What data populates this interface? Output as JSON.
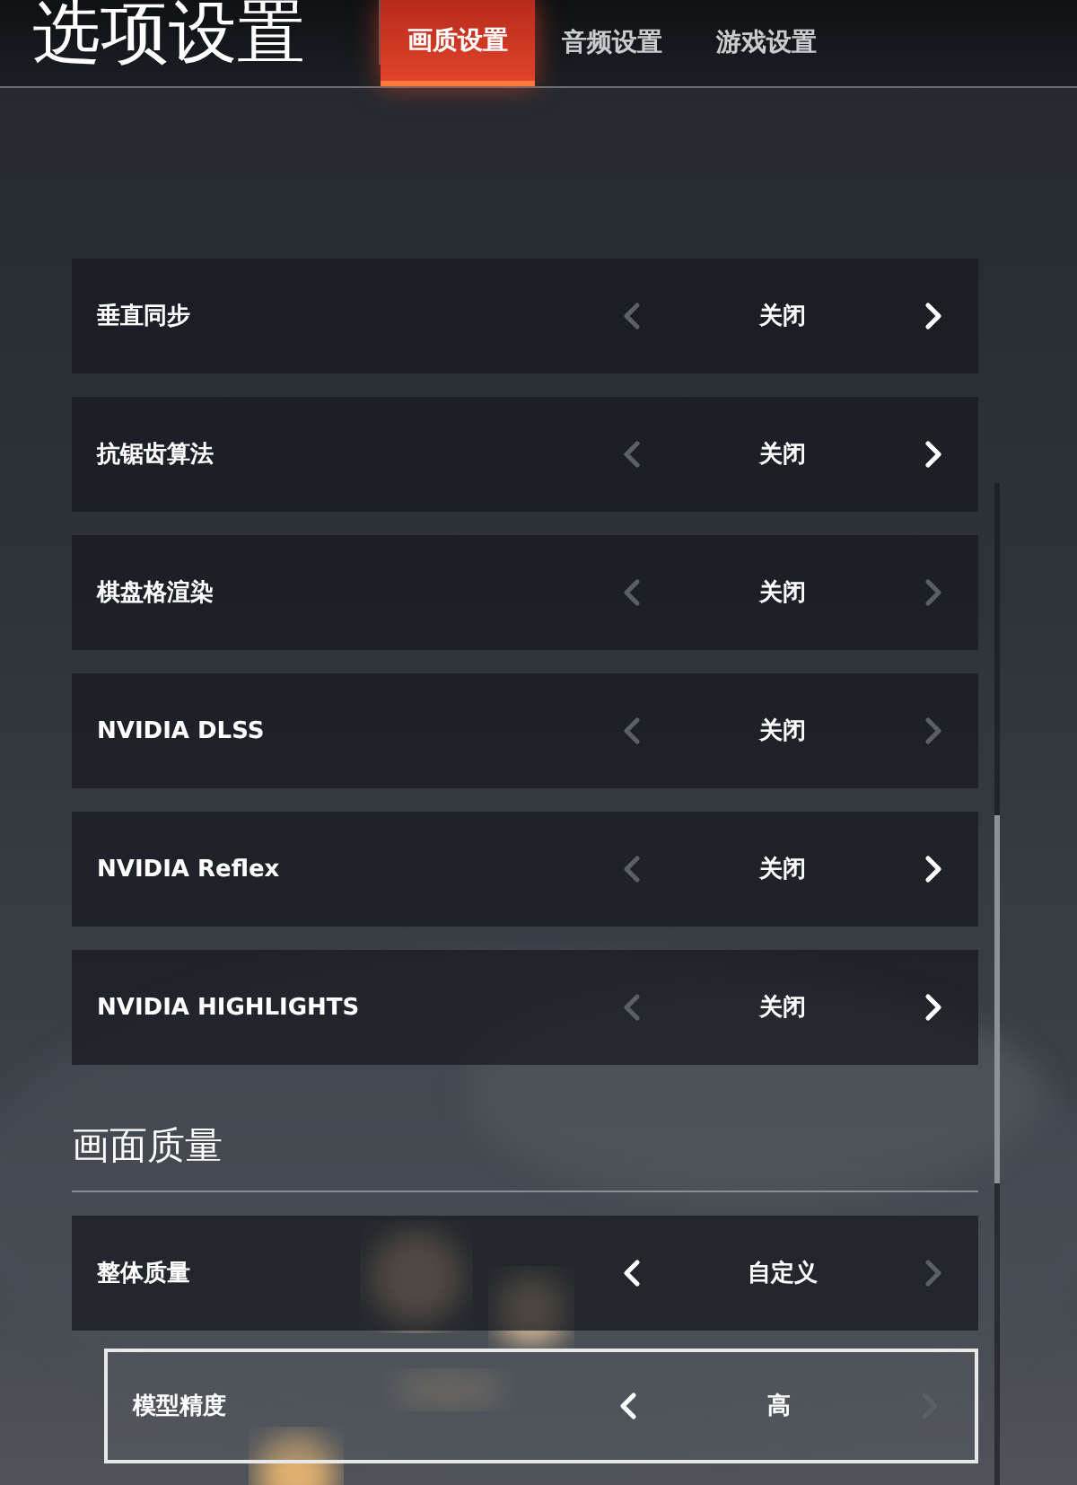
{
  "window": {
    "title": "选项设置"
  },
  "tabs": [
    {
      "label": "画质设置",
      "selected": true
    },
    {
      "label": "音频设置",
      "selected": false
    },
    {
      "label": "游戏设置",
      "selected": false
    }
  ],
  "sections": [
    {
      "settings": [
        {
          "label": "垂直同步",
          "value": "关闭",
          "prev_enabled": false,
          "next_enabled": true,
          "selected": false
        },
        {
          "label": "抗锯齿算法",
          "value": "关闭",
          "prev_enabled": false,
          "next_enabled": true,
          "selected": false
        },
        {
          "label": "棋盘格渲染",
          "value": "关闭",
          "prev_enabled": false,
          "next_enabled": false,
          "selected": false
        },
        {
          "label": "NVIDIA DLSS",
          "value": "关闭",
          "prev_enabled": false,
          "next_enabled": false,
          "selected": false
        },
        {
          "label": "NVIDIA Reflex",
          "value": "关闭",
          "prev_enabled": false,
          "next_enabled": true,
          "selected": false
        },
        {
          "label": "NVIDIA HIGHLIGHTS",
          "value": "关闭",
          "prev_enabled": false,
          "next_enabled": true,
          "selected": false
        }
      ]
    },
    {
      "title": "画面质量",
      "settings": [
        {
          "label": "整体质量",
          "value": "自定义",
          "prev_enabled": true,
          "next_enabled": false,
          "selected": false,
          "children": [
            {
              "label": "模型精度",
              "value": "高",
              "prev_enabled": true,
              "next_enabled": false,
              "selected": true
            }
          ]
        }
      ]
    }
  ]
}
